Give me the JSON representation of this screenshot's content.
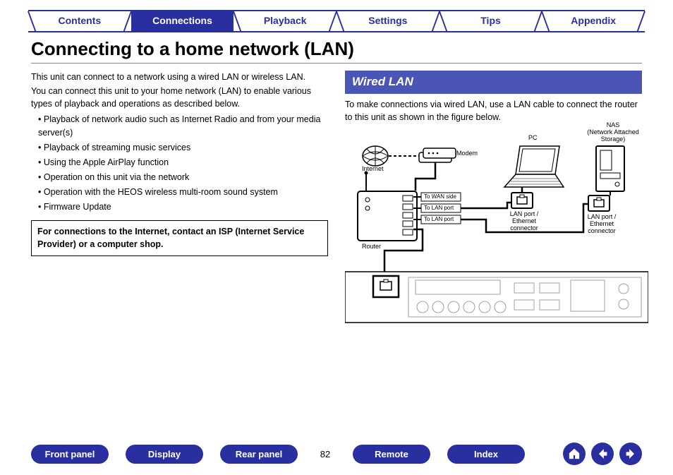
{
  "tabs": {
    "contents": "Contents",
    "connections": "Connections",
    "playback": "Playback",
    "settings": "Settings",
    "tips": "Tips",
    "appendix": "Appendix"
  },
  "title": "Connecting to a home network (LAN)",
  "left": {
    "p1": "This unit can connect to a network using a wired LAN or wireless LAN.",
    "p2": "You can connect this unit to your home network (LAN) to enable various types of playback and operations as described below.",
    "bullets": [
      "Playback of network audio such as Internet Radio and from your media server(s)",
      "Playback of streaming music services",
      "Using the Apple AirPlay function",
      "Operation on this unit via the network",
      "Operation with the HEOS wireless multi-room sound system",
      "Firmware Update"
    ],
    "note": "For connections to the Internet, contact an ISP (Internet Service Provider) or a computer shop."
  },
  "right": {
    "heading": "Wired LAN",
    "p1": "To make connections via wired LAN, use a LAN cable to connect the router to this unit as shown in the figure below.",
    "labels": {
      "internet": "Internet",
      "modem": "Modem",
      "pc": "PC",
      "nas": "NAS\n(Network Attached\nStorage)",
      "router": "Router",
      "to_wan": "To WAN side",
      "to_lan1": "To LAN port",
      "to_lan2": "To LAN port",
      "lanport1": "LAN port /\nEthernet\nconnector",
      "lanport2": "LAN port /\nEthernet\nconnector"
    }
  },
  "bottom": {
    "front_panel": "Front panel",
    "display": "Display",
    "rear_panel": "Rear panel",
    "remote": "Remote",
    "index": "Index",
    "page": "82"
  }
}
